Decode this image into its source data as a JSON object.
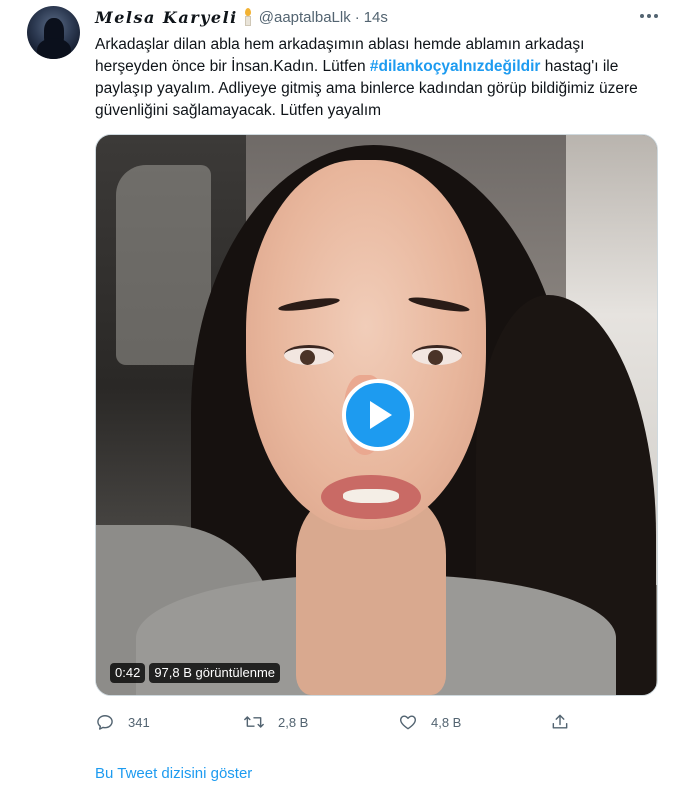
{
  "author": {
    "display_name": "Melsa Karyeli",
    "badge_icon": "candle-icon",
    "handle": "@aaptalbaLlk",
    "separator": "·",
    "time": "14s"
  },
  "tweet": {
    "text_before": "Arkadaşlar dilan abla hem arkadaşımın ablası hemde ablamın arkadaşı herşeyden önce bir İnsan.Kadın. Lütfen ",
    "hashtag": "#dilankoçyalnızdeğildir",
    "text_after": " hastag'ı ile paylaşıp yayalım. Adliyeye gitmiş ama binlerce kadından görüp bildiğimiz üzere güvenliğini sağlamayacak. Lütfen yayalım"
  },
  "video": {
    "duration": "0:42",
    "views": "97,8 B görüntülenme"
  },
  "actions": {
    "reply_count": "341",
    "retweet_count": "2,8 B",
    "like_count": "4,8 B"
  },
  "thread_link": "Bu Tweet dizisini göster",
  "colors": {
    "accent": "#1d9bf0",
    "text": "#0f1419",
    "muted": "#536471"
  }
}
